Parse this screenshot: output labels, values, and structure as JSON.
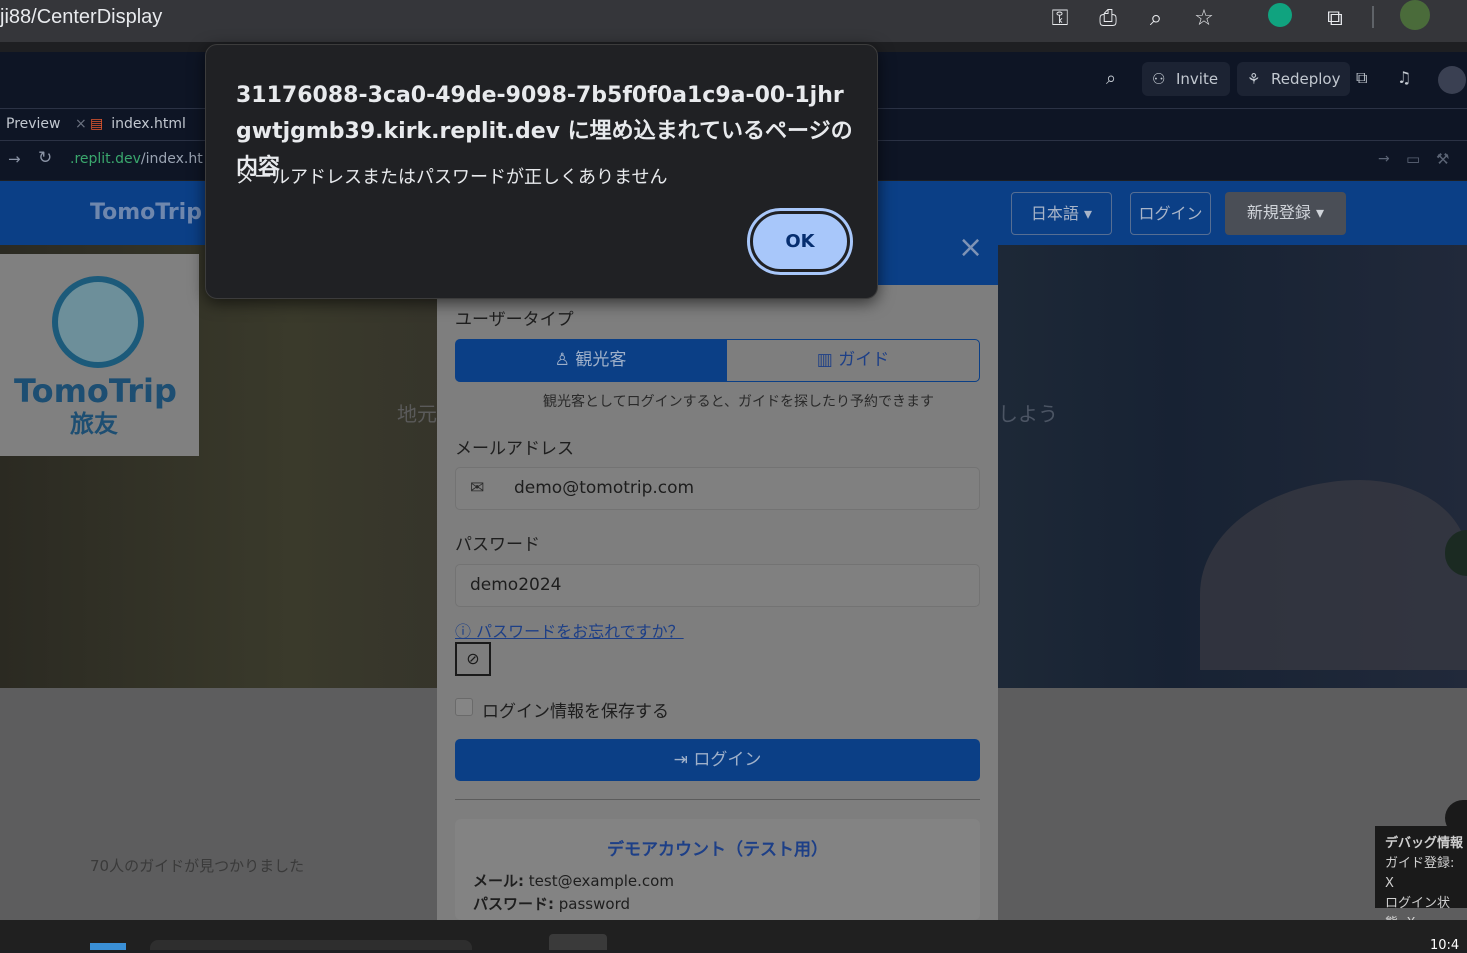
{
  "browser": {
    "url_text": "ji88/CenterDisplay"
  },
  "replit": {
    "invite_label": "Invite",
    "redeploy_label": "Redeploy",
    "tab_preview": "Preview",
    "tab_close": "×",
    "tab_index": "index.html",
    "address_domain": ".replit.dev",
    "address_path": "/index.ht"
  },
  "site": {
    "brand": "TomoTrip",
    "lang_label": "日本語",
    "login_label": "ログイン",
    "signup_label": "新規登録",
    "logo_text": "TomoTrip",
    "logo_sub": "旅友",
    "hero_fragment_left": "地元",
    "hero_fragment_right": "しよう",
    "guides_found": "70人のガイドが見つかりました"
  },
  "modal": {
    "close_label": "×",
    "user_type_label": "ユーザータイプ",
    "tourist_label": "観光客",
    "guide_label": "ガイド",
    "tourist_hint": "観光客としてログインすると、ガイドを探したり予約できます",
    "email_label": "メールアドレス",
    "email_value": "demo@tomotrip.com",
    "password_label": "パスワード",
    "password_value": "demo2024",
    "forgot_label": "パスワードをお忘れですか？",
    "remember_label": "ログイン情報を保存する",
    "login_button": "ログイン",
    "demo_title": "デモアカウント（テスト用）",
    "demo_mail_key": "メール:",
    "demo_mail_val": "test@example.com",
    "demo_pw_key": "パスワード:",
    "demo_pw_val": "password"
  },
  "dialog": {
    "title": "31176088-3ca0-49de-9098-7b5f0f0a1c9a-00-1jhrgwtjgmb39.kirk.replit.dev に埋め込まれているページの内容",
    "message": "メールアドレスまたはパスワードが正しくありません",
    "ok_label": "OK"
  },
  "debug": {
    "title": "デバッグ情報",
    "guide_reg": "ガイド登録: X",
    "login_state": "ログイン状態: X"
  },
  "taskbar": {
    "clock": "10:4"
  },
  "colors": {
    "accent_blue": "#0b3f86",
    "dialog_bg": "#202124",
    "ok_button": "#a8c7fa",
    "link": "#1d3f87"
  }
}
